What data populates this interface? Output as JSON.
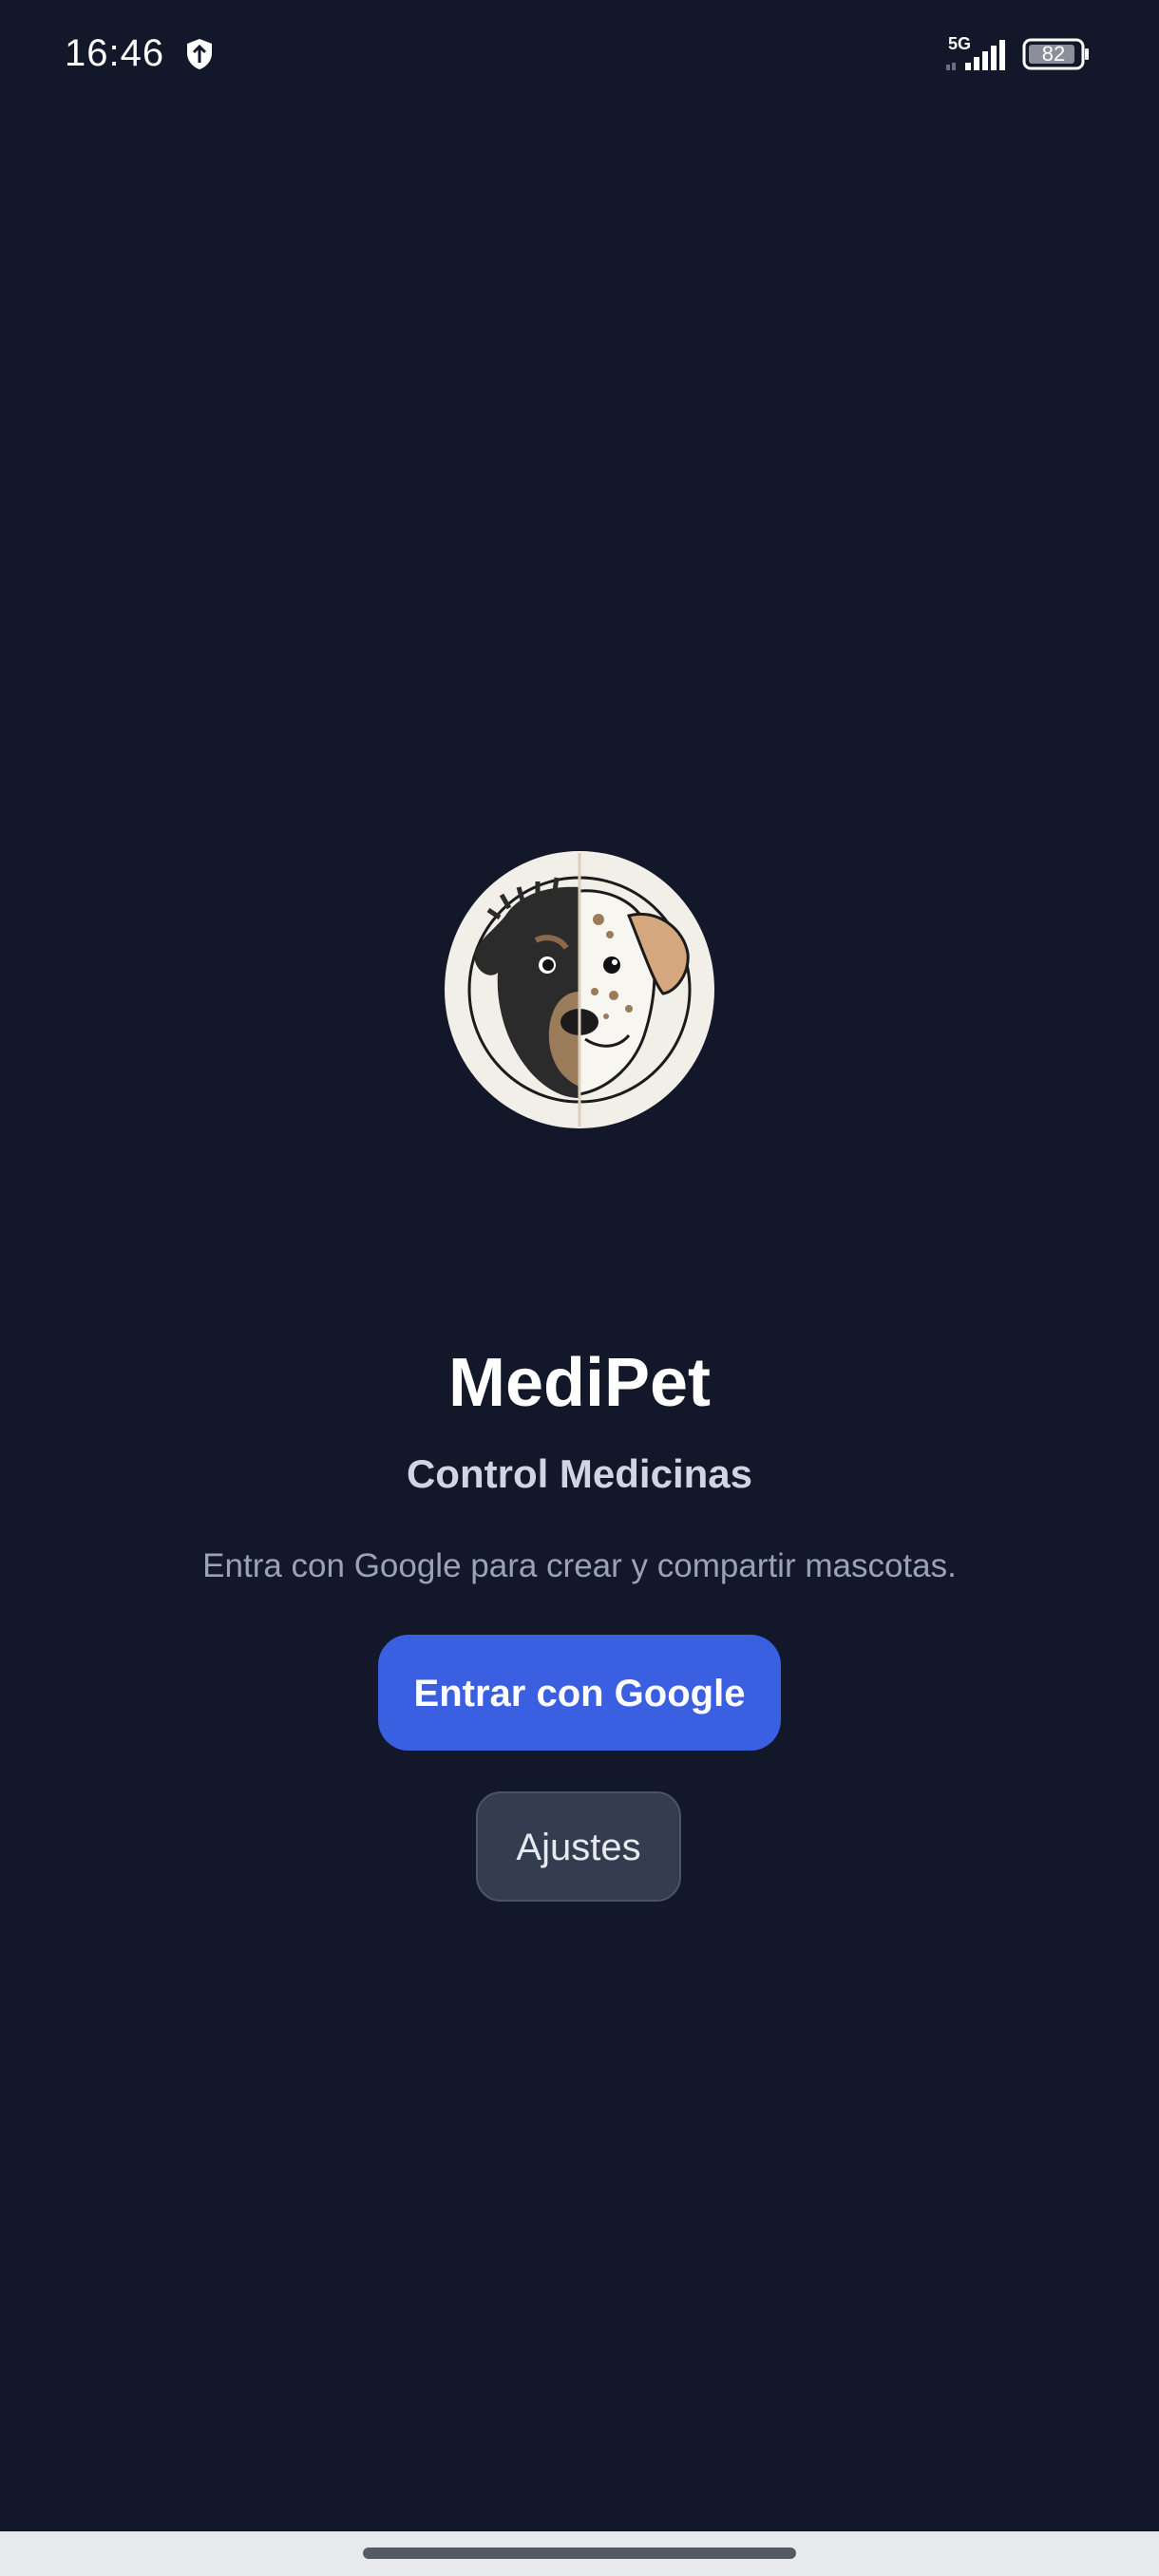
{
  "status_bar": {
    "time": "16:46",
    "network": "5G",
    "battery": "82",
    "icons": [
      "shield-icon",
      "signal-icon",
      "battery-icon"
    ]
  },
  "app": {
    "logo": "dog-logo",
    "title": "MediPet",
    "subtitle": "Control Medicinas",
    "description": "Entra con Google para crear y compartir mascotas."
  },
  "actions": {
    "google_label": "Entrar con Google",
    "settings_label": "Ajustes"
  },
  "colors": {
    "background": "#121729",
    "primary_button": "#3a5fe0",
    "secondary_button": "#333d4f"
  }
}
